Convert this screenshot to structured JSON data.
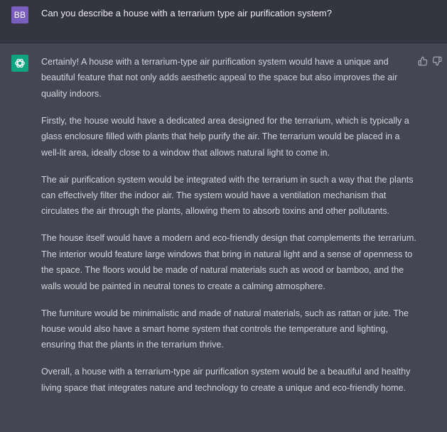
{
  "user_message": {
    "avatar_initials": "BB",
    "text": "Can you describe a house with a terrarium type air purification system?"
  },
  "assistant_message": {
    "avatar_icon": "openai-logo-icon",
    "paragraphs": [
      "Certainly! A house with a terrarium-type air purification system would have a unique and beautiful feature that not only adds aesthetic appeal to the space but also improves the air quality indoors.",
      "Firstly, the house would have a dedicated area designed for the terrarium, which is typically a glass enclosure filled with plants that help purify the air. The terrarium would be placed in a well-lit area, ideally close to a window that allows natural light to come in.",
      "The air purification system would be integrated with the terrarium in such a way that the plants can effectively filter the indoor air. The system would have a ventilation mechanism that circulates the air through the plants, allowing them to absorb toxins and other pollutants.",
      "The house itself would have a modern and eco-friendly design that complements the terrarium. The interior would feature large windows that bring in natural light and a sense of openness to the space. The floors would be made of natural materials such as wood or bamboo, and the walls would be painted in neutral tones to create a calming atmosphere.",
      "The furniture would be minimalistic and made of natural materials, such as rattan or jute. The house would also have a smart home system that controls the temperature and lighting, ensuring that the plants in the terrarium thrive.",
      "Overall, a house with a terrarium-type air purification system would be a beautiful and healthy living space that integrates nature and technology to create a unique and eco-friendly home."
    ]
  },
  "feedback": {
    "up_icon": "thumbs-up-icon",
    "down_icon": "thumbs-down-icon"
  },
  "colors": {
    "user_row_bg": "#343541",
    "assistant_row_bg": "#444654",
    "user_avatar": "#7a5ec0",
    "bot_avatar": "#10a37f",
    "text": "#d1d5db"
  }
}
